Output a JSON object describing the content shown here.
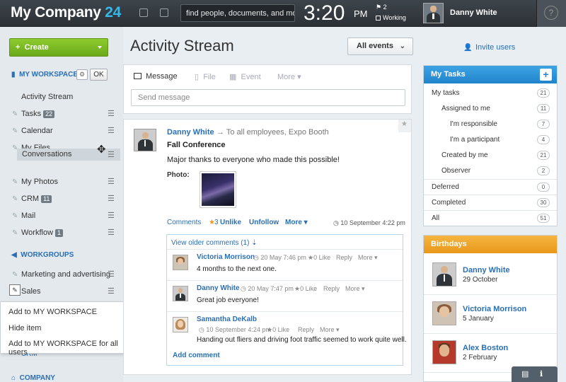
{
  "header": {
    "logo_text": "My Company",
    "logo_num": "24",
    "search_value": "find people, documents, and more",
    "time": "3:20",
    "ampm": "PM",
    "flag_count": "2",
    "status": "Working",
    "username": "Danny White",
    "help": "?"
  },
  "sidebar": {
    "create_label": "Create",
    "workspace_head": "MY WORKSPACE",
    "ok_label": "OK",
    "items": [
      {
        "label": "Activity Stream"
      },
      {
        "label": "Tasks",
        "count": "22"
      },
      {
        "label": "Calendar"
      },
      {
        "label": "My Files"
      },
      {
        "label": "My Photos"
      },
      {
        "label": "CRM",
        "count": "11"
      },
      {
        "label": "Mail"
      },
      {
        "label": "Workflow",
        "count": "1"
      }
    ],
    "dragging_label": "Conversations",
    "workgroups_head": "WORKGROUPS",
    "workgroups": [
      {
        "label": "Marketing and advertising"
      },
      {
        "label": "Sales"
      }
    ],
    "context_menu": [
      "Add to MY WORKSPACE",
      "Hide item",
      "Add to MY WORKSPACE for all users"
    ],
    "hidden_item": "CRM",
    "company_head": "COMPANY"
  },
  "main": {
    "title": "Activity Stream",
    "events_filter": "All events",
    "invite_label": "Invite users",
    "composer": {
      "tabs": [
        "Message",
        "File",
        "Event",
        "More"
      ],
      "placeholder": "Send message"
    },
    "post": {
      "author": "Danny White",
      "destination": "To all employees, Expo Booth",
      "title": "Fall Conference",
      "text": "Major thanks to everyone who made this possible!",
      "photo_label": "Photo:",
      "actions": {
        "comments": "Comments",
        "likes": "3",
        "unlike": "Unlike",
        "unfollow": "Unfollow",
        "more": "More"
      },
      "time": "10 September 4:22 pm",
      "older_comments": "View older comments (1)",
      "comments": [
        {
          "author": "Victoria Morrison",
          "time": "20 May 7:46 pm",
          "likes": "0",
          "like": "Like",
          "reply": "Reply",
          "more": "More",
          "text": "4 months to the next one."
        },
        {
          "author": "Danny White",
          "time": "20 May 7:47 pm",
          "likes": "0",
          "like": "Like",
          "reply": "Reply",
          "more": "More",
          "text": "Great job everyone!"
        },
        {
          "author": "Samantha DeKalb",
          "time": "10 September 4:24 pm",
          "likes": "0",
          "like": "Like",
          "reply": "Reply",
          "more": "More",
          "text": "Handing out fliers and driving foot traffic seemed to work quite well."
        }
      ],
      "add_comment": "Add comment"
    }
  },
  "tasks": {
    "title": "My Tasks",
    "plus": "+",
    "rows": [
      {
        "label": "My tasks",
        "count": "21"
      },
      {
        "label": "Assigned to me",
        "count": "11"
      },
      {
        "label": "I'm responsible",
        "count": "7"
      },
      {
        "label": "I'm a participant",
        "count": "4"
      },
      {
        "label": "Created by me",
        "count": "21"
      },
      {
        "label": "Observer",
        "count": "2"
      },
      {
        "label": "Deferred",
        "count": "0"
      },
      {
        "label": "Completed",
        "count": "30"
      },
      {
        "label": "All",
        "count": "51"
      }
    ]
  },
  "birthdays": {
    "title": "Birthdays",
    "people": [
      {
        "name": "Danny White",
        "date": "29 October"
      },
      {
        "name": "Victoria Morrison",
        "date": "5 January"
      },
      {
        "name": "Alex Boston",
        "date": "2 February"
      }
    ]
  },
  "colors": {
    "accent": "#2a6fb3",
    "create_green": "#7ab925",
    "tasks_blue": "#2a8fd6",
    "birthdays_orange": "#f0a62b",
    "header_dark": "#353b41"
  }
}
